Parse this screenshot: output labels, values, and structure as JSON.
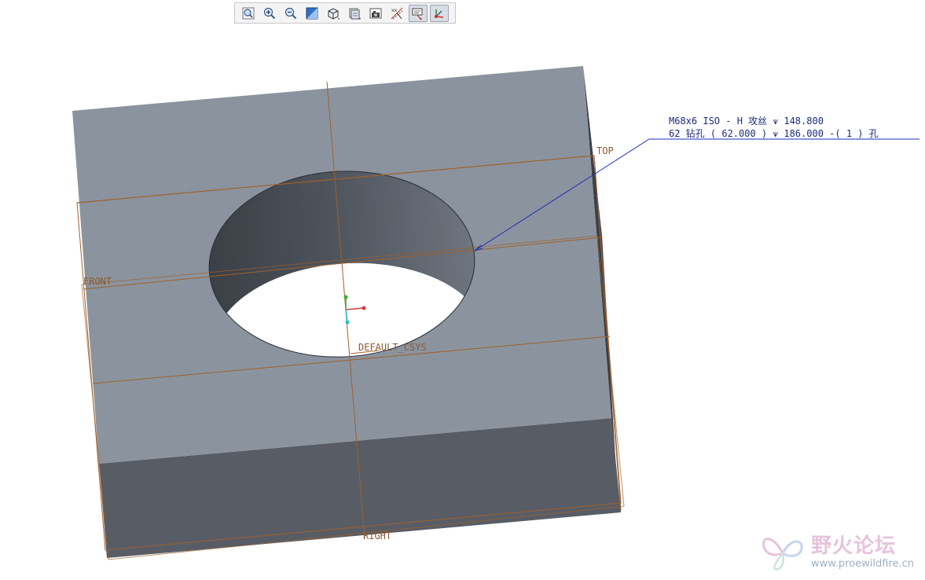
{
  "toolbar": {
    "buttons": [
      {
        "name": "refit-icon"
      },
      {
        "name": "zoom-in-icon"
      },
      {
        "name": "zoom-out-icon"
      },
      {
        "name": "repaint-icon"
      },
      {
        "name": "display-style-icon"
      },
      {
        "name": "saved-views-icon"
      },
      {
        "name": "view-manager-icon"
      },
      {
        "name": "datum-display-icon"
      },
      {
        "name": "annotation-display-icon",
        "active": true
      },
      {
        "name": "spin-center-icon",
        "active": true
      }
    ]
  },
  "model": {
    "datum_planes": {
      "top": "TOP",
      "front": "FRONT",
      "right": "RIGHT"
    },
    "csys_label": "DEFAULT_CSYS",
    "colors": {
      "top_face": "#8b949e",
      "front_face": "#585d65",
      "side_face": "#3b3f46",
      "datum": "#a0602a",
      "leader": "#1a2bb8"
    }
  },
  "hole_note": {
    "line1": "M68x6 ISO - H 攻丝 ⩛ 148.800",
    "line2": "62 钻孔 ( 62.000 ) ⩛ 186.000  -( 1 ) 孔"
  },
  "watermark": {
    "title": "野火论坛",
    "url": "www.proewildfire.cn"
  }
}
